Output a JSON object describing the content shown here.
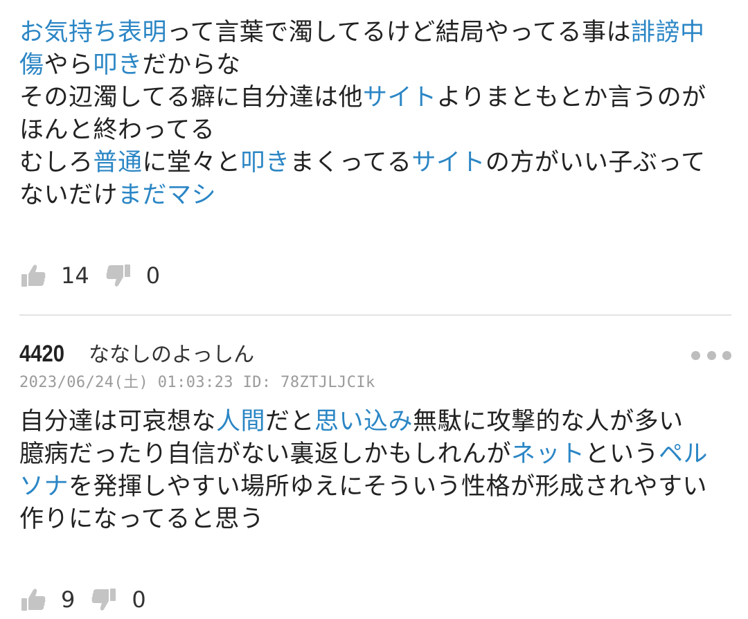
{
  "comments": [
    {
      "lines": [
        [
          {
            "t": "お気持ち表明",
            "link": true
          },
          {
            "t": "って言葉で濁してるけど結局やってる事は",
            "link": false
          },
          {
            "t": "誹謗中",
            "link": true
          }
        ],
        [
          {
            "t": "傷",
            "link": true
          },
          {
            "t": "やら",
            "link": false
          },
          {
            "t": "叩き",
            "link": true
          },
          {
            "t": "だからな",
            "link": false
          }
        ],
        [
          {
            "t": "その辺濁してる癖に自分達は他",
            "link": false
          },
          {
            "t": "サイト",
            "link": true
          },
          {
            "t": "よりまともとか言うのが",
            "link": false
          }
        ],
        [
          {
            "t": "ほんと終わってる",
            "link": false
          }
        ],
        [
          {
            "t": "むしろ",
            "link": false
          },
          {
            "t": "普通",
            "link": true
          },
          {
            "t": "に堂々と",
            "link": false
          },
          {
            "t": "叩き",
            "link": true
          },
          {
            "t": "まくってる",
            "link": false
          },
          {
            "t": "サイト",
            "link": true
          },
          {
            "t": "の方がいい子ぶって",
            "link": false
          }
        ],
        [
          {
            "t": "ないだけ",
            "link": false
          },
          {
            "t": "まだマシ",
            "link": true
          }
        ]
      ],
      "likes": "14",
      "dislikes": "0"
    },
    {
      "res_no": "4420",
      "author": "ななしのよっしん",
      "meta": "2023/06/24(土) 01:03:23 ID: 78ZTJLJCIk",
      "lines": [
        [
          {
            "t": "自分達は可哀想な",
            "link": false
          },
          {
            "t": "人間",
            "link": true
          },
          {
            "t": "だと",
            "link": false
          },
          {
            "t": "思い込み",
            "link": true
          },
          {
            "t": "無駄に攻撃的な人が多い",
            "link": false
          }
        ],
        [
          {
            "t": "臆病だったり自信がない裏返しかもしれんが",
            "link": false
          },
          {
            "t": "ネット",
            "link": true
          },
          {
            "t": "という",
            "link": false
          },
          {
            "t": "ペル",
            "link": true
          }
        ],
        [
          {
            "t": "ソナ",
            "link": true
          },
          {
            "t": "を発揮しやすい場所ゆえにそういう性格が形成されやすい",
            "link": false
          }
        ],
        [
          {
            "t": "作りになってると思う",
            "link": false
          }
        ]
      ],
      "likes": "9",
      "dislikes": "0"
    }
  ],
  "icons": {
    "like": "thumbs-up-icon",
    "dislike": "thumbs-down-icon",
    "more": "more-dots-icon"
  },
  "colors": {
    "link": "#2b86c5",
    "text": "#222222",
    "meta": "#9a9a9a",
    "icon": "#c4c4c4",
    "divider": "#e3e3e3"
  }
}
